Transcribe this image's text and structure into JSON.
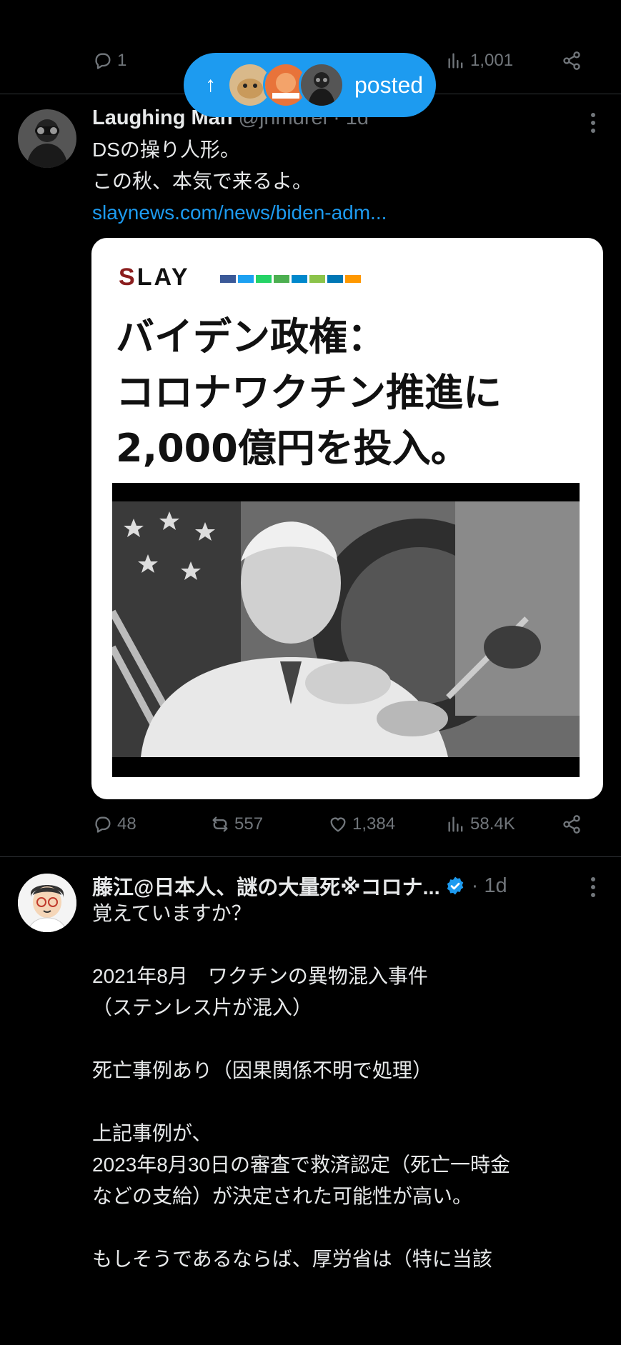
{
  "top_actions": {
    "replies": "1",
    "views": "1,001"
  },
  "pill": {
    "label": "posted",
    "arrow": "↑"
  },
  "tweet1": {
    "name": "Laughing Man",
    "handle": "@jhmdrei",
    "time": "· 1d",
    "text": "DSの操り人形。\nこの秋、本気で来るよ。",
    "link": "slaynews.com/news/biden-adm...",
    "card": {
      "logo_first": "S",
      "logo_rest": "LAY",
      "headline_lines": [
        "バイデン政権：",
        "コロナワクチン推進に",
        "2,000億円を投入。"
      ]
    },
    "actions": {
      "replies": "48",
      "reposts": "557",
      "likes": "1,384",
      "views": "58.4K"
    }
  },
  "tweet2": {
    "name": "藤江@日本人、謎の大量死※コロナ...",
    "time": "· 1d",
    "text": "覚えていますか？\n\n2021年8月　ワクチンの異物混入事件\n（ステンレス片が混入）\n\n死亡事例あり（因果関係不明で処理）\n\n上記事例が、\n2023年8月30日の審査で救済認定（死亡一時金\nなどの支給）が決定された可能性が高い。\n\nもしそうであるならば、厚労省は（特に当該"
  },
  "colors": {
    "accent": "#1d9bf0",
    "muted": "#71767b",
    "background": "#000000",
    "text": "#e7e9ea"
  },
  "icons": [
    "reply-icon",
    "repost-icon",
    "like-icon",
    "views-icon",
    "share-icon",
    "more-icon",
    "verified-icon",
    "arrow-up-icon"
  ]
}
